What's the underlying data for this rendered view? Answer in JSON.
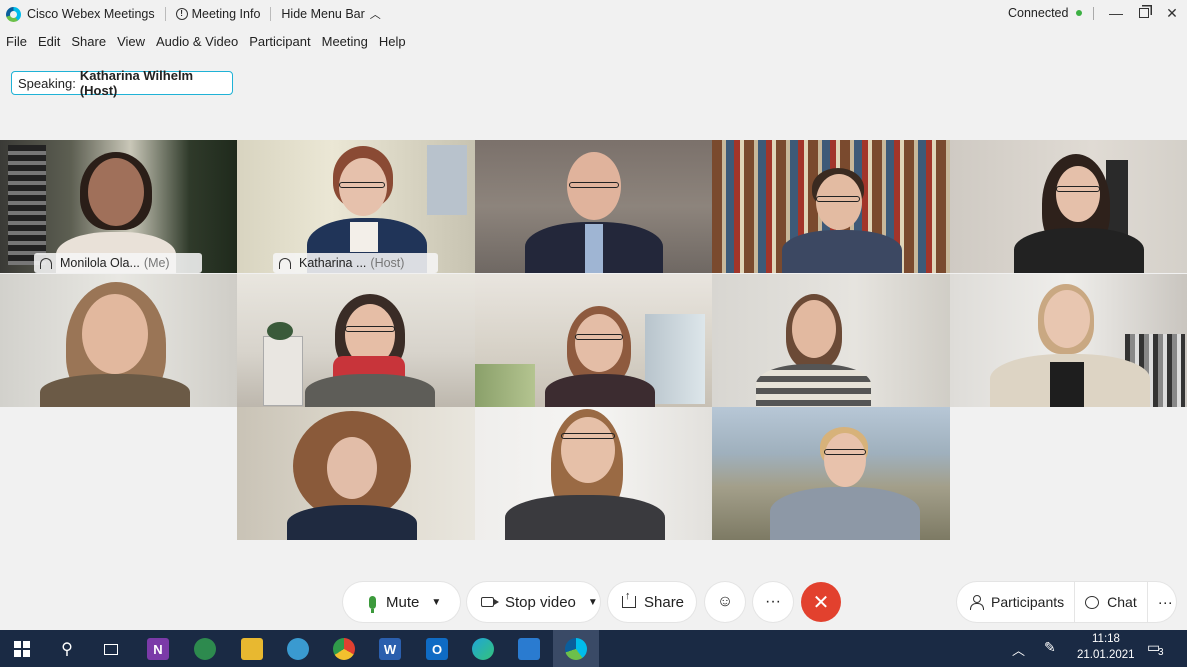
{
  "titlebar": {
    "app_name": "Cisco Webex Meetings",
    "meeting_info": "Meeting Info",
    "hide_menu_bar": "Hide Menu Bar",
    "status": "Connected",
    "status_color": "#3cb043"
  },
  "menu": [
    "File",
    "Edit",
    "Share",
    "View",
    "Audio & Video",
    "Participant",
    "Meeting",
    "Help"
  ],
  "speaking": {
    "label": "Speaking:",
    "name": "Katharina Wilhelm (Host)"
  },
  "tiles": [
    {
      "name": "Monilola Ola...",
      "tag": "(Me)"
    },
    {
      "name": "Katharina ...",
      "tag": "(Host)"
    }
  ],
  "controls": {
    "mute": "Mute",
    "stop_video": "Stop video",
    "share": "Share",
    "more": "···",
    "end": "✕",
    "participants": "Participants",
    "chat": "Chat"
  },
  "taskbar": {
    "time": "11:18",
    "date": "21.01.2021",
    "notifications": "3"
  },
  "accent_color": "#1fb2d6",
  "end_color": "#e2412e"
}
